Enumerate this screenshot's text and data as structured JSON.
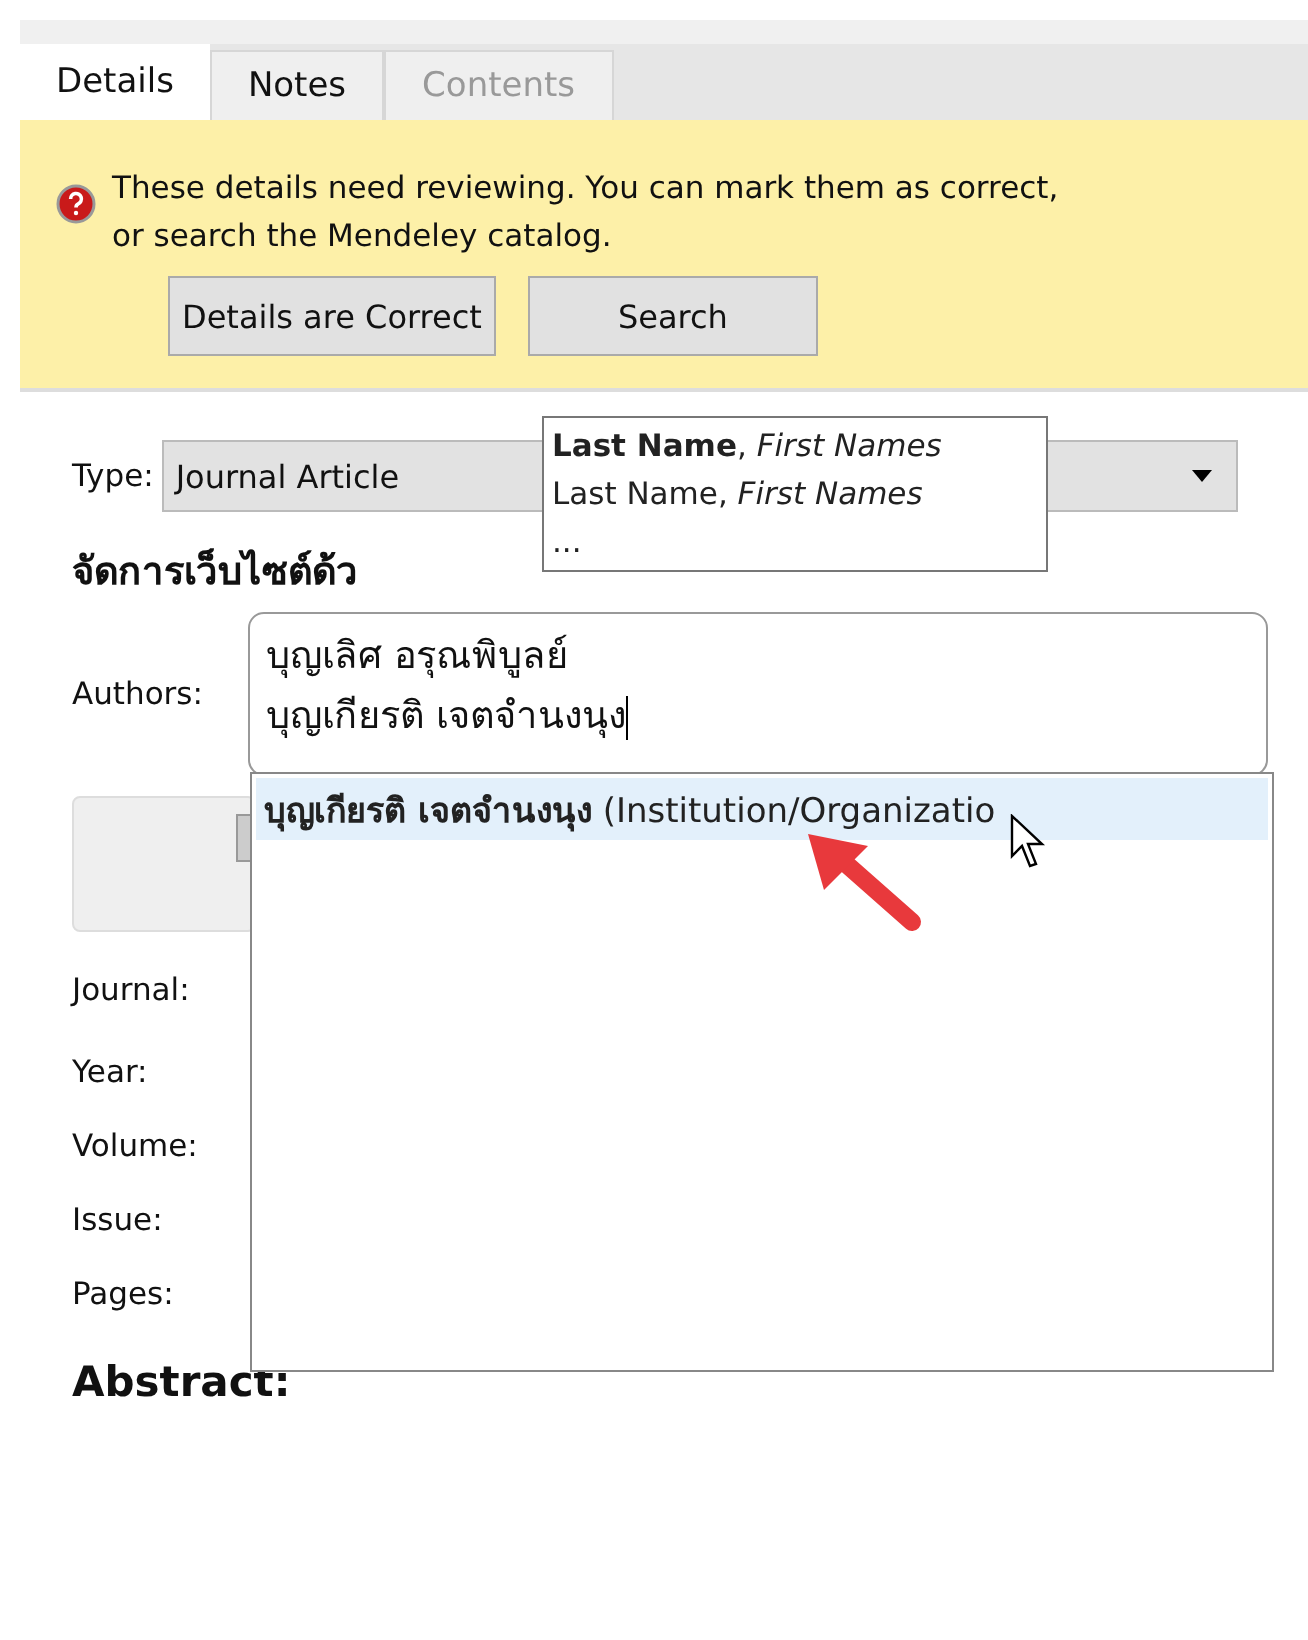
{
  "tabs": [
    {
      "label": "Details",
      "selected": true,
      "disabled": false
    },
    {
      "label": "Notes",
      "selected": false,
      "disabled": false
    },
    {
      "label": "Contents",
      "selected": false,
      "disabled": true
    }
  ],
  "banner": {
    "message": "These details need reviewing. You can mark them as correct,\nor search the Mendeley catalog.",
    "buttons": [
      "Details are Correct",
      "Search"
    ]
  },
  "type_field": {
    "label": "Type:",
    "value": "Journal Article"
  },
  "title": "จัดการเว็บไซต์ด้ว",
  "name_format_tooltip": [
    "**Last Name**, *First Names*",
    "Last Name, *First Names*",
    "..."
  ],
  "authors": {
    "label": "Authors:",
    "lines": [
      "บุญเลิศ อรุณพิบูลย์",
      "บุญเกียรติ เจตจำนงนุง"
    ]
  },
  "suggestions": [
    {
      "text": "**บุญเกียรติ เจตจำนงนุง** (Institution/Organizatio",
      "selected": true
    }
  ],
  "field_labels": [
    "Journal:",
    "Year:",
    "Volume:",
    "Issue:",
    "Pages:"
  ],
  "abstract_heading": "Abstract:"
}
